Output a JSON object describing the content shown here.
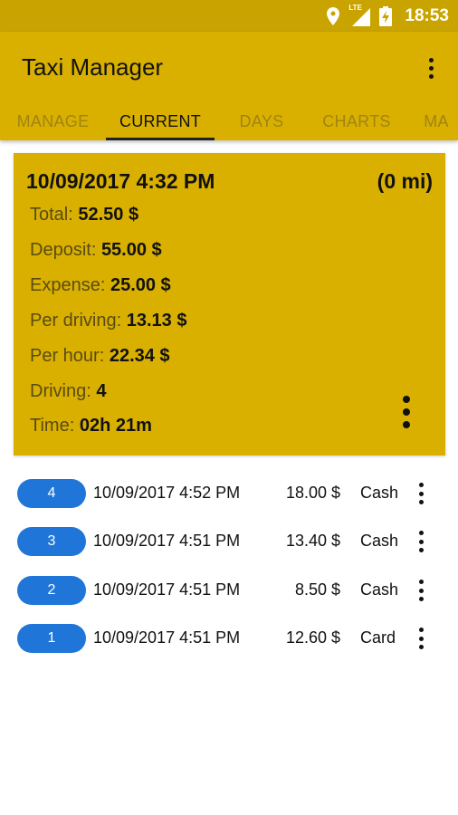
{
  "status_bar": {
    "time": "18:53",
    "network": "LTE",
    "icons": [
      "location-icon",
      "signal-icon",
      "battery-charging-icon"
    ]
  },
  "app": {
    "title": "Taxi Manager",
    "menu_icon": "overflow-menu-icon"
  },
  "tabs": [
    {
      "label": "MANAGE",
      "active": false
    },
    {
      "label": "CURRENT",
      "active": true
    },
    {
      "label": "DAYS",
      "active": false
    },
    {
      "label": "CHARTS",
      "active": false
    },
    {
      "label": "MA",
      "active": false
    }
  ],
  "summary": {
    "date": "10/09/2017 4:32 PM",
    "distance": "(0 mi)",
    "stats": [
      {
        "label": "Total: ",
        "value": "52.50 $"
      },
      {
        "label": "Deposit: ",
        "value": "55.00 $"
      },
      {
        "label": "Expense: ",
        "value": "25.00 $"
      },
      {
        "label": "Per driving: ",
        "value": "13.13 $"
      },
      {
        "label": "Per hour: ",
        "value": "22.34 $"
      },
      {
        "label": "Driving: ",
        "value": "4"
      },
      {
        "label": "Time: ",
        "value": "02h 21m"
      }
    ]
  },
  "trips": [
    {
      "number": "4",
      "time": "10/09/2017 4:52 PM",
      "amount": "18.00 $",
      "method": "Cash"
    },
    {
      "number": "3",
      "time": "10/09/2017 4:51 PM",
      "amount": "13.40 $",
      "method": "Cash"
    },
    {
      "number": "2",
      "time": "10/09/2017 4:51 PM",
      "amount": "8.50 $",
      "method": "Cash"
    },
    {
      "number": "1",
      "time": "10/09/2017 4:51 PM",
      "amount": "12.60 $",
      "method": "Card"
    }
  ],
  "colors": {
    "status_bar": "#c9a400",
    "app_bar": "#d9b000",
    "badge": "#1f76d8"
  }
}
